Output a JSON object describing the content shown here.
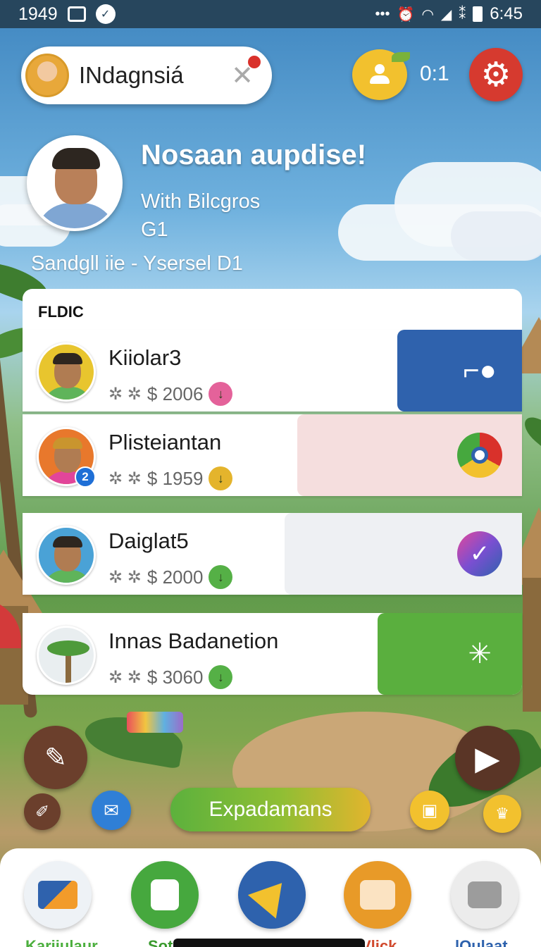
{
  "status_bar": {
    "left_text": "1949",
    "time": "6:45",
    "icons": [
      "image-icon",
      "notification-icon",
      "dots-icon",
      "alarm-icon",
      "wifi-icon",
      "signal-icon",
      "battery-icon"
    ]
  },
  "top_bar": {
    "profile_name": "INdagnsiá",
    "close_icon": "close-icon",
    "score": "0:1",
    "friend_icon": "person-icon",
    "settings_icon": "gear-icon"
  },
  "hero": {
    "title": "Nosaan aupdise!",
    "subtitle": "With Bilcgros",
    "subtitle2": "G1",
    "line": "Sandgll iie - Ysersel D1"
  },
  "list": {
    "header": "FLDIC",
    "rows": [
      {
        "name": "Kiiolar3",
        "amount": "$ 2006",
        "arrow_color": "#e4629a",
        "panel_color": "#2f62ad",
        "icon": "share-icon",
        "avatar_bg": "#e8c52e"
      },
      {
        "name": "Plisteiantan",
        "amount": "$ 1959",
        "arrow_color": "#e4b42c",
        "panel_color": "#f5dede",
        "icon": "chrome-icon",
        "avatar_bg": "#e8782c",
        "badge": "2"
      },
      {
        "name": "Daiglat5",
        "amount": "$ 2000",
        "arrow_color": "#55b046",
        "panel_color": "#eef0f3",
        "icon": "check-icon",
        "avatar_bg": "#4aa2d6"
      },
      {
        "name": "Innas Badanetion",
        "amount": "$ 3060",
        "arrow_color": "#55b046",
        "panel_color": "#5aaf3e",
        "icon": "sun-icon",
        "avatar_bg": "#e9eef0"
      }
    ]
  },
  "controls": {
    "expand_label": "Expadamans",
    "play_icon": "play-icon"
  },
  "dock": {
    "items": [
      {
        "label": "Kariiulaur",
        "color": "#f29b2a",
        "label_color": "#4caf3e"
      },
      {
        "label": "Sot",
        "color": "#46a83e",
        "label_color": "#3a9a2e"
      },
      {
        "label": "",
        "color": "#2e62ad",
        "label_color": "#2e62ad"
      },
      {
        "label": "Vlick",
        "color": "#e89a28",
        "label_color": "#d14a2e"
      },
      {
        "label": "lOulaat",
        "color": "#ececec",
        "label_color": "#2e62ad"
      }
    ]
  }
}
